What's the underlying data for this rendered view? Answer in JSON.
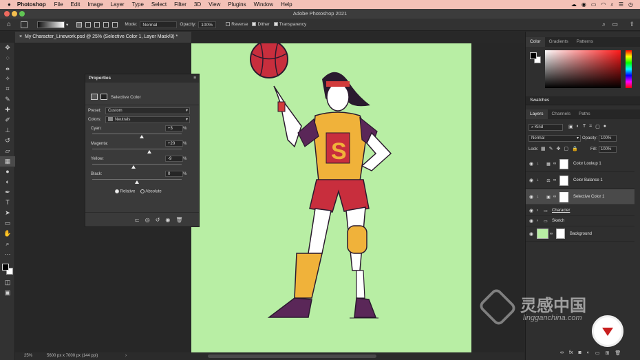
{
  "menubar": {
    "app": "Photoshop",
    "items": [
      "File",
      "Edit",
      "Image",
      "Layer",
      "Type",
      "Select",
      "Filter",
      "3D",
      "View",
      "Plugins",
      "Window",
      "Help"
    ]
  },
  "window": {
    "title": "Adobe Photoshop 2021"
  },
  "options": {
    "mode_label": "Mode:",
    "mode_value": "Normal",
    "opacity_label": "Opacity:",
    "opacity_value": "100%",
    "reverse": "Reverse",
    "dither": "Dither",
    "transparency": "Transparency"
  },
  "document": {
    "tab_title": "My Character_Linework.psd @ 25% (Selective Color 1, Layer Mask/8) *"
  },
  "status": {
    "zoom": "25%",
    "size": "5600 px x 7000 px (144 ppi)"
  },
  "properties": {
    "title": "Properties",
    "adjustment": "Selective Color",
    "preset_label": "Preset:",
    "preset_value": "Custom",
    "colors_label": "Colors:",
    "colors_value": "Neutrals",
    "sliders": [
      {
        "label": "Cyan:",
        "value": "+3",
        "pos": 0.55
      },
      {
        "label": "Magenta:",
        "value": "+20",
        "pos": 0.64
      },
      {
        "label": "Yellow:",
        "value": "-9",
        "pos": 0.46
      },
      {
        "label": "Black:",
        "value": "0",
        "pos": 0.5
      }
    ],
    "pct": "%",
    "relative": "Relative",
    "absolute": "Absolute"
  },
  "color_panel": {
    "tabs": [
      "Color",
      "Gradients",
      "Patterns"
    ]
  },
  "swatches": {
    "title": "Swatches"
  },
  "layers_panel": {
    "tabs": [
      "Layers",
      "Channels",
      "Paths"
    ],
    "kind": "Kind",
    "blend": "Normal",
    "opacity_label": "Opacity:",
    "opacity_value": "100%",
    "lock_label": "Lock:",
    "fill_label": "Fill:",
    "fill_value": "100%",
    "layers": [
      {
        "name": "Color Lookup 1",
        "icon": "grid-icon"
      },
      {
        "name": "Color Balance 1",
        "icon": "balance-icon"
      },
      {
        "name": "Selective Color 1",
        "icon": "selective-color-icon"
      },
      {
        "name": "Character",
        "icon": "folder-icon"
      },
      {
        "name": "Sketch",
        "icon": "folder-icon"
      },
      {
        "name": "Background",
        "icon": "image-icon"
      }
    ]
  },
  "watermark": {
    "text": "灵感中国",
    "url": "lingganchina.com"
  },
  "colors": {
    "canvas": "#b8eea4",
    "menubar": "#f3c1b7"
  }
}
